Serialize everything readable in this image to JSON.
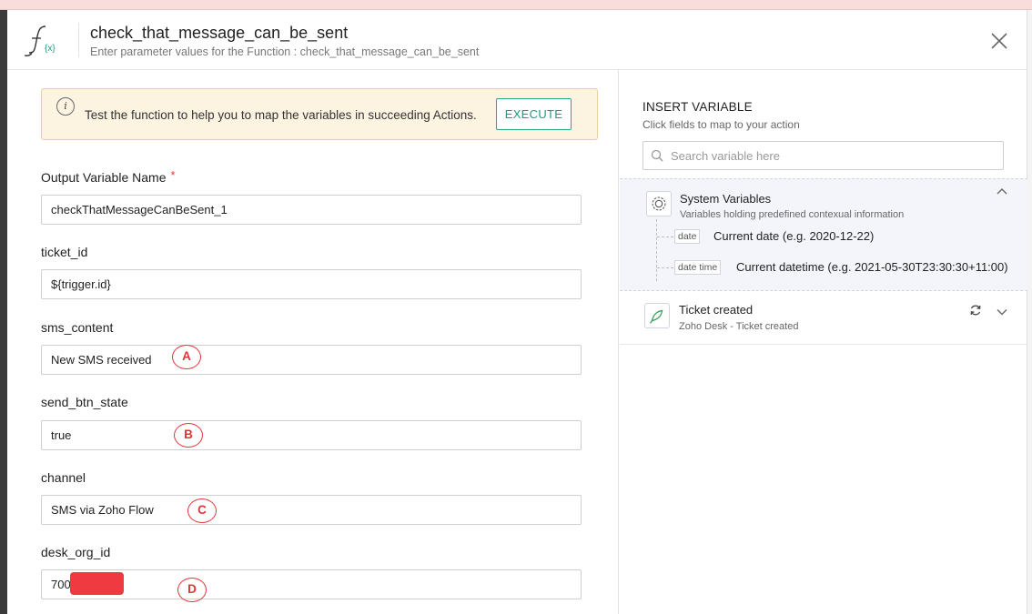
{
  "header": {
    "title": "check_that_message_can_be_sent",
    "subtitle": "Enter parameter values for the Function : check_that_message_can_be_sent",
    "logo_icon": "function-fx-icon",
    "logo_text": "{x}"
  },
  "banner": {
    "info_icon_glyph": "i",
    "text": "Test the function to help you to map the variables in succeeding Actions.",
    "execute_label": "EXECUTE"
  },
  "fields": [
    {
      "label": "Output Variable Name",
      "required_mark": "*",
      "value": "checkThatMessageCanBeSent_1",
      "marker": ""
    },
    {
      "label": "ticket_id",
      "value": "${trigger.id}",
      "marker": ""
    },
    {
      "label": "sms_content",
      "value": "New SMS received",
      "marker": "A"
    },
    {
      "label": "send_btn_state",
      "value": "true",
      "marker": "B"
    },
    {
      "label": "channel",
      "value": "SMS via Zoho Flow",
      "marker": "C"
    },
    {
      "label": "desk_org_id",
      "value": "700",
      "marker": "D"
    }
  ],
  "insert_variable": {
    "title": "INSERT VARIABLE",
    "subtitle": "Click fields to map to your action",
    "search_placeholder": "Search variable here",
    "system_variables": {
      "title": "System Variables",
      "subtitle": "Variables holding predefined contexual information",
      "items": [
        {
          "tag": "date",
          "desc": "Current date (e.g. 2020-12-22)"
        },
        {
          "tag": "date time",
          "desc": "Current datetime (e.g. 2021-05-30T23:30:30+11:00)"
        }
      ]
    },
    "trigger": {
      "title": "Ticket created",
      "subtitle": "Zoho Desk - Ticket created"
    }
  },
  "colors": {
    "accent": "#1f9a80",
    "banner_bg": "#fdf3e1",
    "marker_red": "#e0363b",
    "required_red": "#ee3333"
  }
}
